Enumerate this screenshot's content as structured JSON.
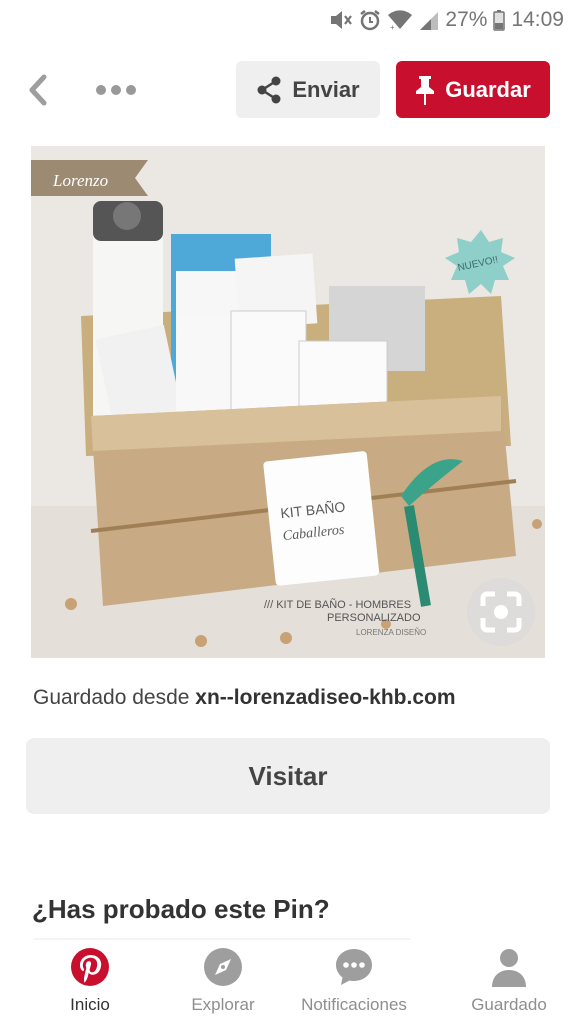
{
  "status_bar": {
    "battery": "27%",
    "time": "14:09",
    "icons": [
      "mute-icon",
      "alarm-icon",
      "wifi-icon",
      "signal-icon",
      "battery-icon"
    ]
  },
  "toolbar": {
    "send_label": "Enviar",
    "save_label": "Guardar"
  },
  "pin": {
    "brand_tag": "Lorenzo",
    "tag_line1": "KIT BAÑO",
    "tag_line2": "Caballeros",
    "badge": "NUEVO!!",
    "caption_line1": "/// KIT DE BAÑO - HOMBRES",
    "caption_line2": "PERSONALIZADO",
    "caption_brand": "LORENZA DISEÑO"
  },
  "source": {
    "prefix": "Guardado desde ",
    "domain": "xn--lorenzadiseo-khb.com"
  },
  "visit_label": "Visitar",
  "section_title": "¿Has probado este Pin?",
  "nav": [
    {
      "label": "Inicio",
      "icon": "pinterest-logo-icon",
      "active": true
    },
    {
      "label": "Explorar",
      "icon": "compass-icon",
      "active": false
    },
    {
      "label": "Notificaciones",
      "icon": "chat-bubble-icon",
      "active": false
    },
    {
      "label": "Guardado",
      "icon": "profile-icon",
      "active": false
    }
  ],
  "colors": {
    "accent": "#c8102e",
    "button_bg": "#efefef",
    "icon_gray": "#9e9e9e"
  }
}
